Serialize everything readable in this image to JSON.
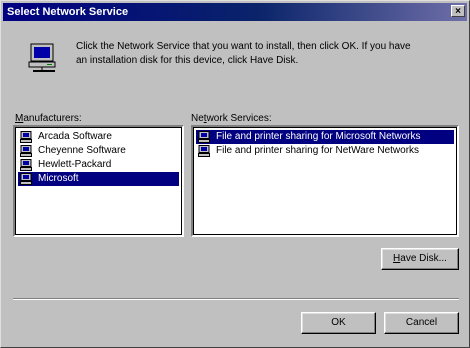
{
  "window": {
    "title": "Select Network Service",
    "close_glyph": "×"
  },
  "intro": {
    "line1": "Click the Network Service that you want to install, then click OK. If you have",
    "line2": "an installation disk for this device, click Have Disk."
  },
  "manufacturers": {
    "label_ul": "M",
    "label_rest": "anufacturers:",
    "items": [
      "Arcada Software",
      "Cheyenne Software",
      "Hewlett-Packard",
      "Microsoft"
    ],
    "selected_index": 3
  },
  "services": {
    "label_pre": "Ne",
    "label_ul": "t",
    "label_rest": "work Services:",
    "items": [
      "File and printer sharing for Microsoft Networks",
      "File and printer sharing for NetWare Networks"
    ],
    "selected_index": 0
  },
  "buttons": {
    "have_disk_ul": "H",
    "have_disk_rest": "ave Disk...",
    "ok": "OK",
    "cancel": "Cancel"
  },
  "colors": {
    "face": "#c0c0c0",
    "title_gradient_start": "#000080",
    "selection": "#000080"
  },
  "icons": {
    "intro": "network-computer-icon",
    "list_item": "network-service-icon"
  }
}
